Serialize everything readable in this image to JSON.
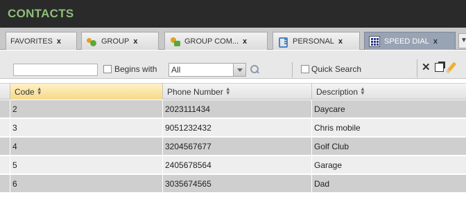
{
  "header": {
    "title": "CONTACTS"
  },
  "tabs": [
    {
      "label": "FAVORITES",
      "icon": null,
      "close": "x",
      "active": false
    },
    {
      "label": "GROUP",
      "icon": "group-icon",
      "close": "x",
      "active": false
    },
    {
      "label": "GROUP COM...",
      "icon": "group-common-icon",
      "close": "x",
      "active": false
    },
    {
      "label": "PERSONAL",
      "icon": "personal-directory-icon",
      "close": "x",
      "active": false
    },
    {
      "label": "SPEED DIAL",
      "icon": "speed-dial-grid-icon",
      "close": "x",
      "active": true
    }
  ],
  "tab_overflow": "▼",
  "search": {
    "value": "",
    "begins_with_label": "Begins with",
    "begins_with_checked": false,
    "filter_value": "All",
    "quick_search_label": "Quick Search",
    "quick_search_checked": false
  },
  "toolbar_icons": [
    "search-icon",
    "clear-icon",
    "popout-icon",
    "edit-icon"
  ],
  "table": {
    "columns": [
      "Code",
      "Phone Number",
      "Description"
    ],
    "sorted_column": "Code",
    "rows": [
      {
        "code": "2",
        "phone": "2023111434",
        "description": "Daycare"
      },
      {
        "code": "3",
        "phone": "9051232432",
        "description": "Chris mobile"
      },
      {
        "code": "4",
        "phone": "3204567677",
        "description": "Golf Club"
      },
      {
        "code": "5",
        "phone": "2405678564",
        "description": "Garage"
      },
      {
        "code": "6",
        "phone": "3035674565",
        "description": "Dad"
      }
    ]
  },
  "colors": {
    "title_text": "#8fbf7a",
    "titlebar_bg": "#2a2a2a",
    "active_tab_bg": "#98a3b3",
    "sorted_header_bg": "#f6d98a"
  }
}
